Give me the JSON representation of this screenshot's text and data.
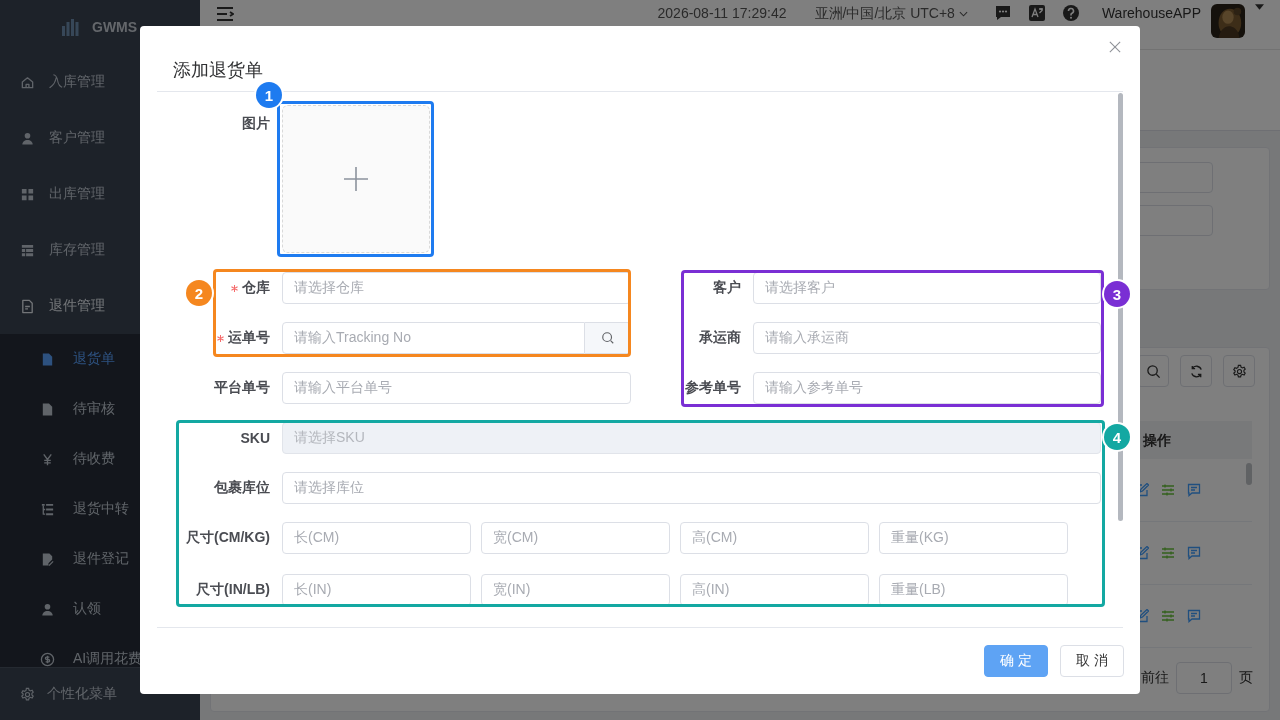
{
  "sidebar": {
    "logo": "GWMS",
    "menu": [
      {
        "label": "入库管理",
        "expanded": false
      },
      {
        "label": "客户管理",
        "expanded": false
      },
      {
        "label": "出库管理",
        "expanded": false
      },
      {
        "label": "库存管理",
        "expanded": false
      },
      {
        "label": "退件管理",
        "expanded": true,
        "children": [
          {
            "label": "退货单",
            "selected": true
          },
          {
            "label": "待审核",
            "selected": false
          },
          {
            "label": "待收费",
            "selected": false
          },
          {
            "label": "退货中转",
            "selected": false
          },
          {
            "label": "退件登记",
            "selected": false
          },
          {
            "label": "认领",
            "selected": false
          },
          {
            "label": "AI调用花费",
            "selected": false
          }
        ]
      }
    ],
    "footer": "个性化菜单"
  },
  "header": {
    "datetime": "2026-08-11 17:29:42",
    "timezone": "亚洲/中国/北京 UTC+8",
    "user": "WarehouseAPP"
  },
  "table": {
    "columns": [
      "操作"
    ],
    "rows": [
      {
        "kind": "actions"
      },
      {
        "kind": "actions"
      },
      {
        "kind": "actions"
      }
    ]
  },
  "pagination": {
    "goto_label": "前往",
    "page": "1",
    "unit": "页"
  },
  "dialog": {
    "title": "添加退货单",
    "upload_label": "图片",
    "left_fields": [
      {
        "label": "仓库",
        "placeholder": "请选择仓库",
        "required": true,
        "search_button": false
      },
      {
        "label": "运单号",
        "placeholder": "请输入Tracking No",
        "required": true,
        "search_button": true
      },
      {
        "label": "平台单号",
        "placeholder": "请输入平台单号",
        "required": false,
        "search_button": false
      }
    ],
    "right_fields": [
      {
        "label": "客户",
        "placeholder": "请选择客户",
        "required": false
      },
      {
        "label": "承运商",
        "placeholder": "请输入承运商",
        "required": false
      },
      {
        "label": "参考单号",
        "placeholder": "请输入参考单号",
        "required": false
      }
    ],
    "full_fields": [
      {
        "label": "SKU",
        "placeholder": "请选择SKU",
        "disabled": true
      },
      {
        "label": "包裹库位",
        "placeholder": "请选择库位",
        "disabled": false
      }
    ],
    "dimension_rows": [
      {
        "label": "尺寸(CM/KG)",
        "placeholders": [
          "长(CM)",
          "宽(CM)",
          "高(CM)",
          "重量(KG)"
        ]
      },
      {
        "label": "尺寸(IN/LB)",
        "placeholders": [
          "长(IN)",
          "宽(IN)",
          "高(IN)",
          "重量(LB)"
        ]
      }
    ],
    "buttons": [
      {
        "label": "确 定",
        "kind": "primary"
      },
      {
        "label": "取 消",
        "kind": "default"
      }
    ]
  },
  "annotations": [
    {
      "number": "1",
      "color": "#1e7bf0"
    },
    {
      "number": "2",
      "color": "#f5871f"
    },
    {
      "number": "3",
      "color": "#7a2fd4"
    },
    {
      "number": "4",
      "color": "#13a8a2"
    }
  ]
}
